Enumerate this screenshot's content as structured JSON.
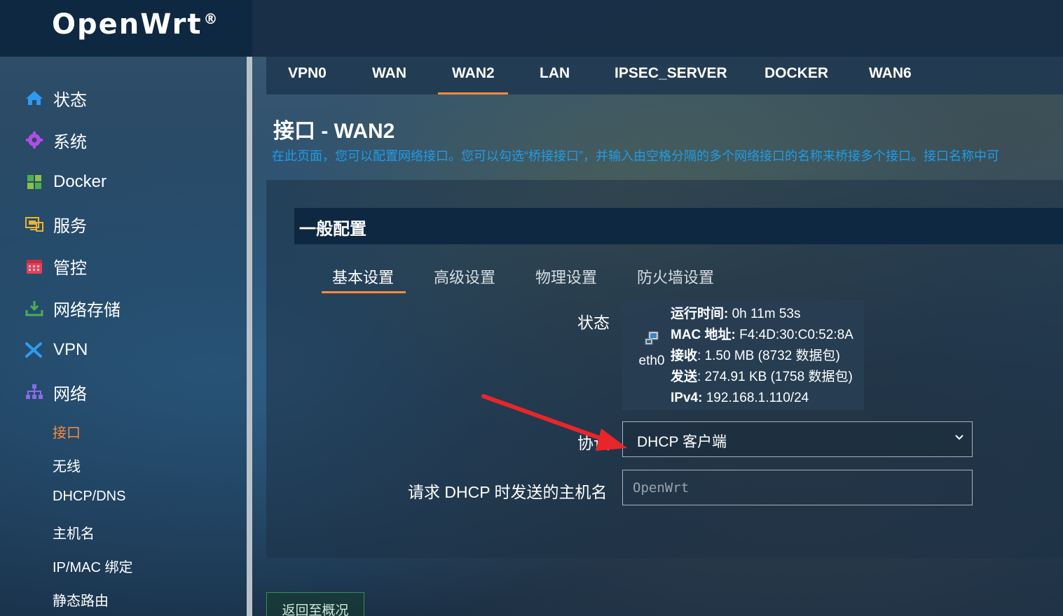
{
  "app": {
    "logo_text": "OpenWrt",
    "logo_mark": "®"
  },
  "sidebar": {
    "items": [
      {
        "label": "状态",
        "icon": "home-icon"
      },
      {
        "label": "系统",
        "icon": "gear-icon"
      },
      {
        "label": "Docker",
        "icon": "grid-icon"
      },
      {
        "label": "服务",
        "icon": "monitor-icon"
      },
      {
        "label": "管控",
        "icon": "calendar-icon"
      },
      {
        "label": "网络存储",
        "icon": "download-icon"
      },
      {
        "label": "VPN",
        "icon": "plane-icon"
      },
      {
        "label": "网络",
        "icon": "network-icon"
      }
    ],
    "sub_items": [
      {
        "label": "接口",
        "active": true
      },
      {
        "label": "无线"
      },
      {
        "label": "DHCP/DNS"
      },
      {
        "label": "主机名"
      },
      {
        "label": "IP/MAC 绑定"
      },
      {
        "label": "静态路由"
      }
    ]
  },
  "tabs": [
    "VPN0",
    "WAN",
    "WAN2",
    "LAN",
    "IPSEC_SERVER",
    "DOCKER",
    "WAN6"
  ],
  "active_tab": "WAN2",
  "page": {
    "title": "接口 - WAN2",
    "description": "在此页面，您可以配置网络接口。您可以勾选“桥接接口”，并输入由空格分隔的多个网络接口的名称来桥接多个接口。接口名称中可"
  },
  "section": {
    "title": "一般配置",
    "subtabs": [
      "基本设置",
      "高级设置",
      "物理设置",
      "防火墙设置"
    ],
    "active_subtab": "基本设置"
  },
  "fields": {
    "status_label": "状态",
    "interface_name": "eth0",
    "status": {
      "uptime_label": "运行时间:",
      "uptime_value": " 0h 11m 53s",
      "mac_label": "MAC 地址:",
      "mac_value": " F4:4D:30:C0:52:8A",
      "rx_label": "接收",
      "rx_value": ": 1.50 MB (8732 数据包)",
      "tx_label": "发送",
      "tx_value": ": 274.91 KB (1758 数据包)",
      "ipv4_label": "IPv4:",
      "ipv4_value": " 192.168.1.110/24"
    },
    "protocol_label": "协议",
    "protocol_value": "DHCP  客户端",
    "hostname_label": "请求 DHCP 时发送的主机名",
    "hostname_placeholder": "OpenWrt"
  },
  "buttons": {
    "back": "返回至概况"
  },
  "colors": {
    "accent": "#ff8a3d",
    "link": "#1e9ce8",
    "header_bg": "#0f2841",
    "arrow": "#e8262a"
  }
}
